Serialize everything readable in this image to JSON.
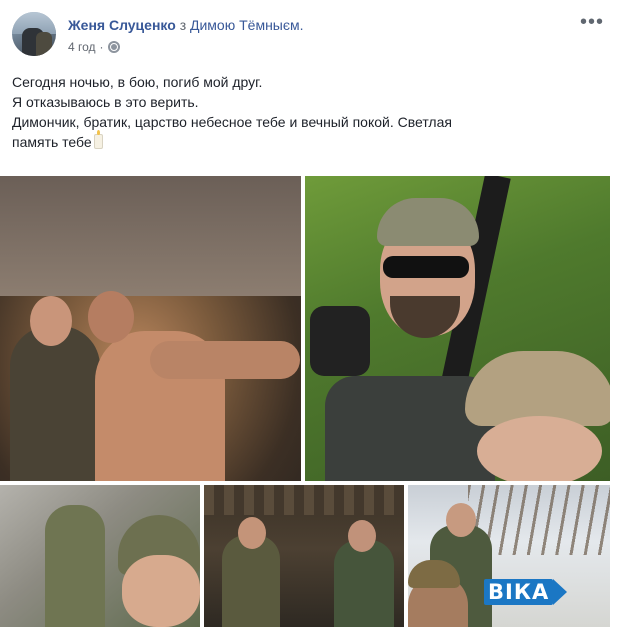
{
  "post": {
    "author": "Женя Слуценко",
    "with_text": "з",
    "tagged": "Димою Тёмныєм.",
    "time": "4 год",
    "separator": "·",
    "privacy_icon": "globe-icon",
    "more_icon": "more-icon",
    "more_glyph": "•••",
    "text_lines": [
      "Сегодня ночью, в бою, погиб мой друг.",
      "Я отказываюсь в это верить.",
      "Димончик, братик, царство небесное тебе и вечный покой. Светлая",
      "память тебе"
    ],
    "emoji_icon": "candle-icon"
  },
  "photos": {
    "count": 5,
    "watermark": "ВІКА"
  }
}
